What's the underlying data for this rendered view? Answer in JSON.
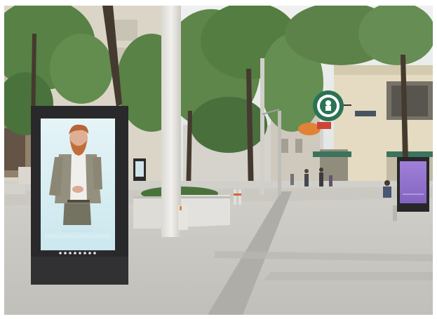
{
  "image": {
    "kind": "street photograph",
    "scene": "pedestrian shopping street with digital advertising kiosks, trees and a coffee shop sign"
  },
  "kiosk_left": {
    "screen_caption": "................................................"
  },
  "palette": {
    "sky": "#e9ecec",
    "pavement": "#c7c6c1",
    "tree_green": "#4b6f36",
    "kiosk_frame": "#1c1c1e",
    "ad_background": "#d7eef3",
    "purple_screen": "#8a68c9",
    "building_cream": "#e6dcc4",
    "logo_green": "#1f6a4a"
  }
}
